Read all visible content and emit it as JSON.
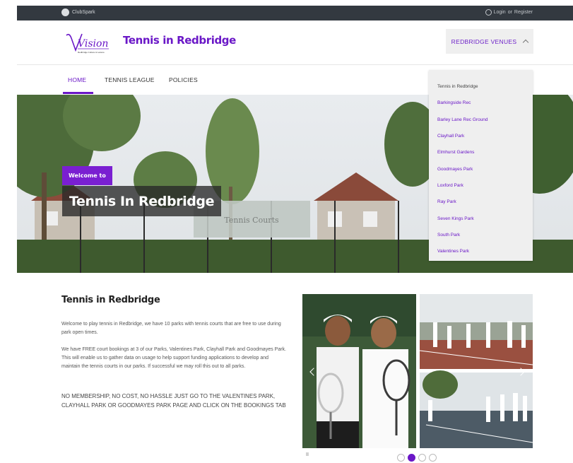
{
  "topbar": {
    "brand": "ClubSpark",
    "login": "Login",
    "or": "or",
    "register": "Register"
  },
  "header": {
    "logo_word": "Vision",
    "logo_tagline": "Redbridge Culture & Leisure",
    "site_title": "Tennis in Redbridge",
    "venues_button": "REDBRIDGE VENUES"
  },
  "nav": {
    "items": [
      "HOME",
      "TENNIS LEAGUE",
      "POLICIES"
    ],
    "active_index": 0
  },
  "dropdown": {
    "options": [
      "Tennis in Redbridge",
      "Barkingside Rec",
      "Barley Lane Rec Ground",
      "Clayhall Park",
      "Elmhurst Gardens",
      "Goodmayes Park",
      "Loxford Park",
      "Ray Park",
      "Seven Kings Park",
      "South Park",
      "Valentines Park"
    ]
  },
  "hero": {
    "badge": "Welcome to",
    "title": "Tennis In Redbridge",
    "banner_text": "Tennis Courts"
  },
  "content": {
    "title": "Tennis in Redbridge",
    "para1": "Welcome to play tennis in Redbridge, we have 10 parks with tennis courts that are free to use during park open times.",
    "para2": "We have FREE court bookings at 3 of our Parks, Valentines Park, Clayhall Park and Goodmayes Park. This will enable us to gather data on usage to help support funding applications to develop and maintain the tennis courts in our parks. If successful we may roll this out to all parks.",
    "para3": "NO MEMBERSHIP, NO COST, NO HASSLE JUST GO TO THE VALENTINES PARK, CLAYHALL PARK OR GOODMAYES PARK PAGE AND CLICK ON THE BOOKINGS TAB"
  },
  "carousel": {
    "pause": "II",
    "slide_count": 4,
    "active_slide": 1
  },
  "colors": {
    "brand_purple": "#6a17c7",
    "topbar": "#333940",
    "dropdown_bg": "#efefef"
  },
  "icons": [
    "clubspark-logo-icon",
    "user-icon",
    "chevron-up-icon",
    "carousel-prev-icon",
    "carousel-next-icon",
    "pause-icon"
  ]
}
